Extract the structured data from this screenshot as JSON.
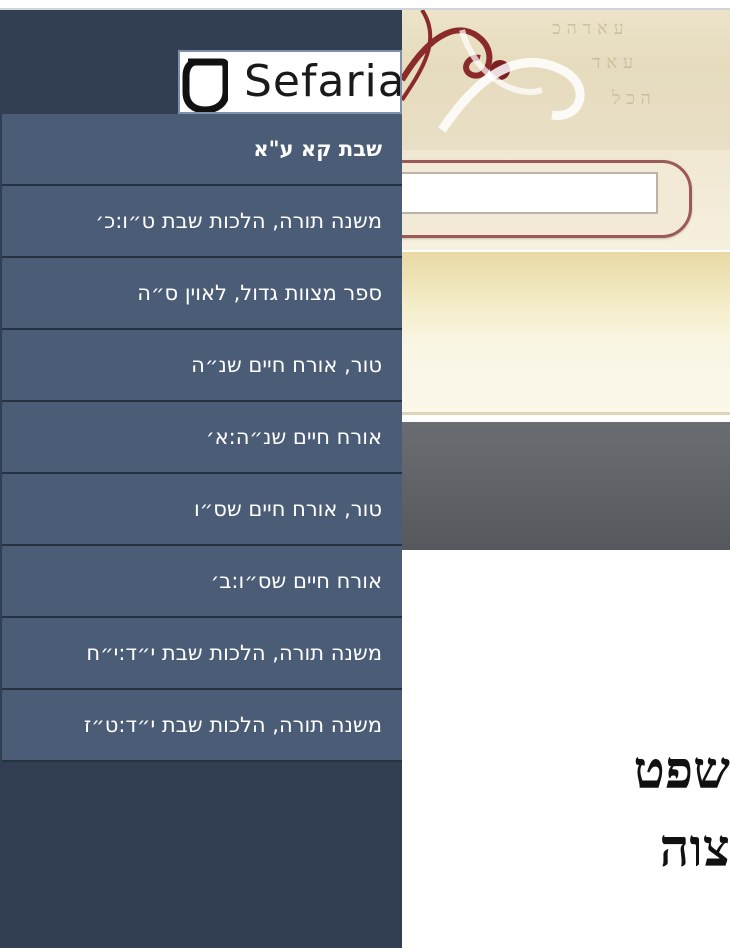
{
  "brand": {
    "name": "Sefaria",
    "logo_glyph": "ס"
  },
  "menu": {
    "items": [
      {
        "label": "שבת קא ע\"א"
      },
      {
        "label": "משנה תורה, הלכות שבת ט״ו:כ׳"
      },
      {
        "label": "ספר מצוות גדול, לאוין ס״ה"
      },
      {
        "label": "טור, אורח חיים שנ״ה"
      },
      {
        "label": "אורח חיים שנ״ה:א׳"
      },
      {
        "label": "טור, אורח חיים שס״ו"
      },
      {
        "label": "אורח חיים שס״ו:ב׳"
      },
      {
        "label": "משנה תורה, הלכות שבת י״ד:י״ח"
      },
      {
        "label": "משנה תורה, הלכות שבת י״ד:ט״ז"
      }
    ]
  },
  "page": {
    "heading_line1": "שפט",
    "heading_line2": "צוה",
    "search_value": ""
  },
  "colors": {
    "menu_bg": "#323f52",
    "menu_item_bg": "#4b5d76",
    "accent_red": "#9b5a55"
  },
  "icons": {
    "logo": "sefaria-logo-icon"
  }
}
